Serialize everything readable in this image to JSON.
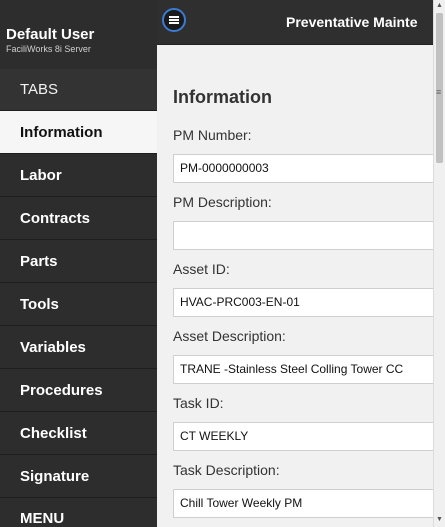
{
  "user": {
    "name": "Default User",
    "server": "FaciliWorks 8i Server"
  },
  "header": {
    "title": "Preventative Mainte"
  },
  "sidebar": {
    "header": "TABS",
    "items": [
      {
        "label": "Information"
      },
      {
        "label": "Labor"
      },
      {
        "label": "Contracts"
      },
      {
        "label": "Parts"
      },
      {
        "label": "Tools"
      },
      {
        "label": "Variables"
      },
      {
        "label": "Procedures"
      },
      {
        "label": "Checklist"
      },
      {
        "label": "Signature"
      },
      {
        "label": "MENU"
      }
    ]
  },
  "main": {
    "section_title": "Information",
    "fields": [
      {
        "label": "PM Number:",
        "value": "PM-0000000003"
      },
      {
        "label": "PM Description:",
        "value": ""
      },
      {
        "label": "Asset ID:",
        "value": "HVAC-PRC003-EN-01"
      },
      {
        "label": "Asset Description:",
        "value": "TRANE -Stainless Steel Colling Tower CC"
      },
      {
        "label": "Task ID:",
        "value": "CT WEEKLY"
      },
      {
        "label": "Task Description:",
        "value": "Chill Tower Weekly PM"
      }
    ]
  },
  "scrollbar": {
    "up_arrow": "▲",
    "down_arrow": "▼"
  },
  "misc": {
    "edge_mark": "≡"
  },
  "colors": {
    "sidebar_bg": "#2d2d2d",
    "active_bg": "#f6f6f6",
    "menu_ring": "#3a7bd5"
  }
}
